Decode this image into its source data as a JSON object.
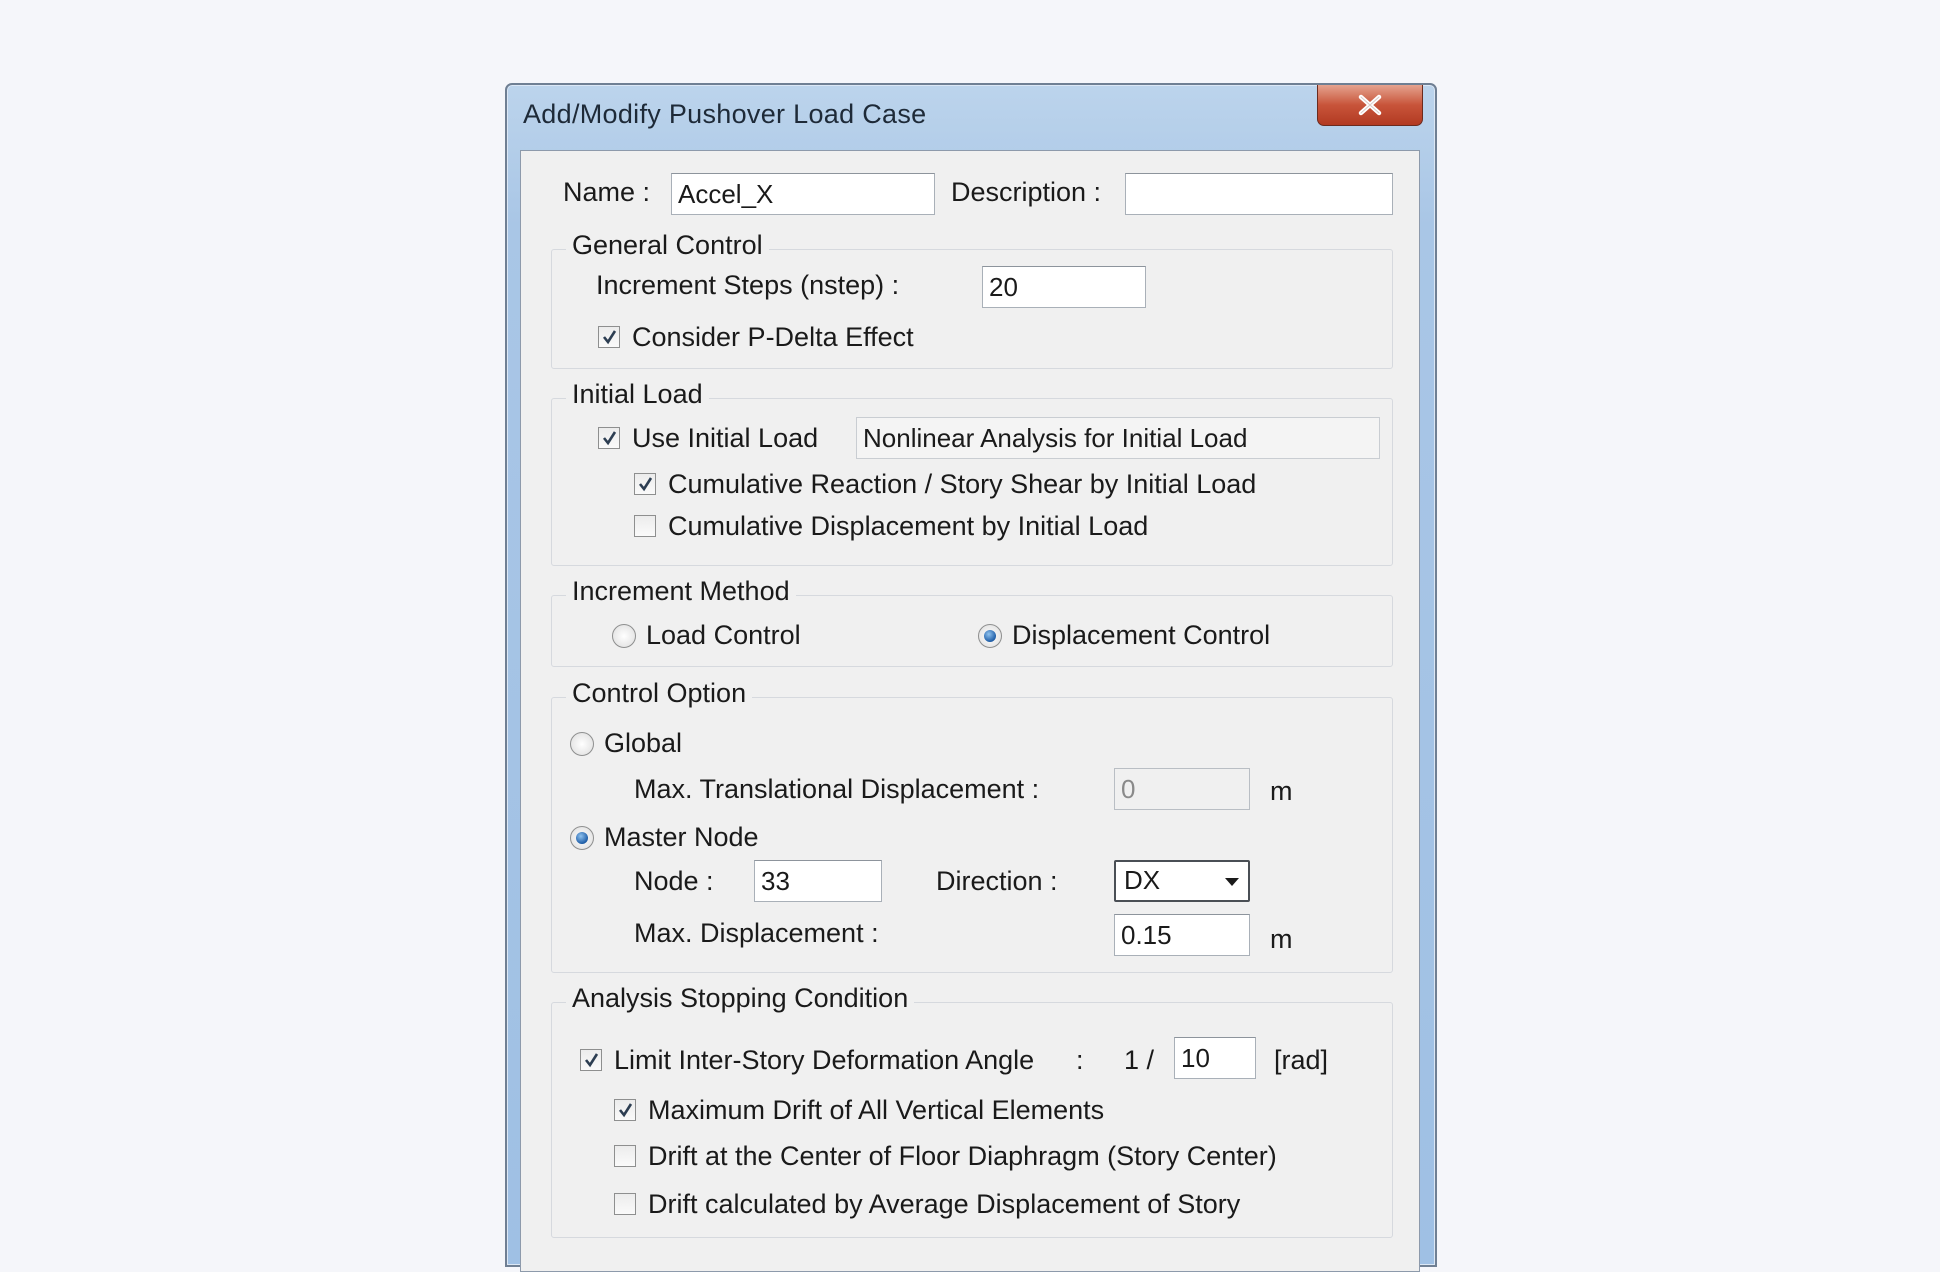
{
  "dialog": {
    "title": "Add/Modify Pushover Load Case",
    "close_glyph": "X"
  },
  "header": {
    "name_label": "Name :",
    "name_value": "Accel_X",
    "description_label": "Description :",
    "description_value": ""
  },
  "general_control": {
    "legend": "General Control",
    "increment_steps_label": "Increment Steps (nstep) :",
    "increment_steps_value": "20",
    "pdelta_label": "Consider P-Delta Effect",
    "pdelta_checked": true
  },
  "initial_load": {
    "legend": "Initial Load",
    "use_initial_label": "Use Initial Load",
    "use_initial_checked": true,
    "initial_load_value": "Nonlinear Analysis for Initial Load",
    "cumulative_reaction_label": "Cumulative Reaction / Story Shear by Initial Load",
    "cumulative_reaction_checked": true,
    "cumulative_displacement_label": "Cumulative Displacement by Initial Load",
    "cumulative_displacement_checked": false
  },
  "increment_method": {
    "legend": "Increment Method",
    "load_control_label": "Load Control",
    "displacement_control_label": "Displacement Control",
    "selected": "Displacement Control"
  },
  "control_option": {
    "legend": "Control Option",
    "global_label": "Global",
    "max_translational_label": "Max. Translational Displacement :",
    "max_translational_value": "0",
    "unit_m": "m",
    "master_node_label": "Master Node",
    "selected": "Master Node",
    "node_label": "Node :",
    "node_value": "33",
    "direction_label": "Direction :",
    "direction_value": "DX",
    "max_displacement_label": "Max. Displacement :",
    "max_displacement_value": "0.15"
  },
  "stopping_condition": {
    "legend": "Analysis Stopping Condition",
    "limit_label": "Limit Inter-Story Deformation Angle",
    "limit_colon": ":",
    "limit_checked": true,
    "ratio_prefix": "1 /",
    "ratio_value": "10",
    "unit_rad": "[rad]",
    "max_drift_label": "Maximum Drift of All Vertical Elements",
    "max_drift_checked": true,
    "center_drift_label": "Drift at the Center of Floor Diaphragm (Story Center)",
    "center_drift_checked": false,
    "average_drift_label": "Drift calculated by Average Displacement of Story",
    "average_drift_checked": false
  },
  "colors": {
    "titlebar": "#a9c6e6",
    "close_button": "#c8543a",
    "client_bg": "#f0f0f0"
  },
  "icons": [
    "close-icon",
    "checkmark-icon",
    "dropdown-arrow-icon"
  ]
}
